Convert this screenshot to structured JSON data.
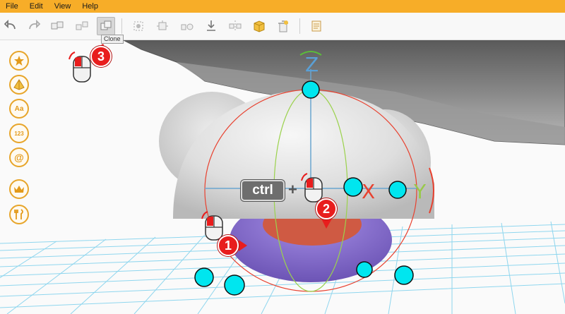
{
  "menubar": {
    "items": [
      "File",
      "Edit",
      "View",
      "Help"
    ]
  },
  "toolbar": {
    "buttons": [
      {
        "icon": "undo-icon"
      },
      {
        "icon": "redo-icon"
      },
      {
        "icon": "group-icon"
      },
      {
        "icon": "ungroup-icon"
      },
      {
        "icon": "clone-icon",
        "active": true
      },
      {
        "icon": "align-icon"
      },
      {
        "icon": "snap-icon"
      },
      {
        "icon": "distribute-icon"
      },
      {
        "icon": "drop-to-floor-icon"
      },
      {
        "icon": "mirror-icon"
      },
      {
        "icon": "solid-box-icon"
      },
      {
        "icon": "delete-icon"
      },
      {
        "icon": "notes-icon"
      }
    ],
    "tooltip": "Clone"
  },
  "sidebar": {
    "buttons": [
      {
        "icon": "star-icon"
      },
      {
        "icon": "shapes-icon"
      },
      {
        "icon": "text-icon",
        "text": "Aa"
      },
      {
        "icon": "numbers-icon",
        "text": "123"
      },
      {
        "icon": "symbols-icon",
        "text": "@"
      },
      {
        "icon": "crown-icon"
      },
      {
        "icon": "tools-icon"
      }
    ]
  },
  "overlay": {
    "ctrl_key": "ctrl",
    "plus": "+",
    "steps": [
      "1",
      "2",
      "3"
    ]
  },
  "gizmo": {
    "axis_x": "X",
    "axis_y": "Y",
    "axis_z": "Z"
  },
  "colors": {
    "menubar": "#f7ad28",
    "accent": "#e7a52a",
    "badge": "#e81d1d",
    "grid": "#8fd6ee",
    "handle": "#00e6ef",
    "object_gray": "#dcdcdc",
    "object_purple": "#8a6fd3",
    "object_red": "#cf5a43"
  }
}
